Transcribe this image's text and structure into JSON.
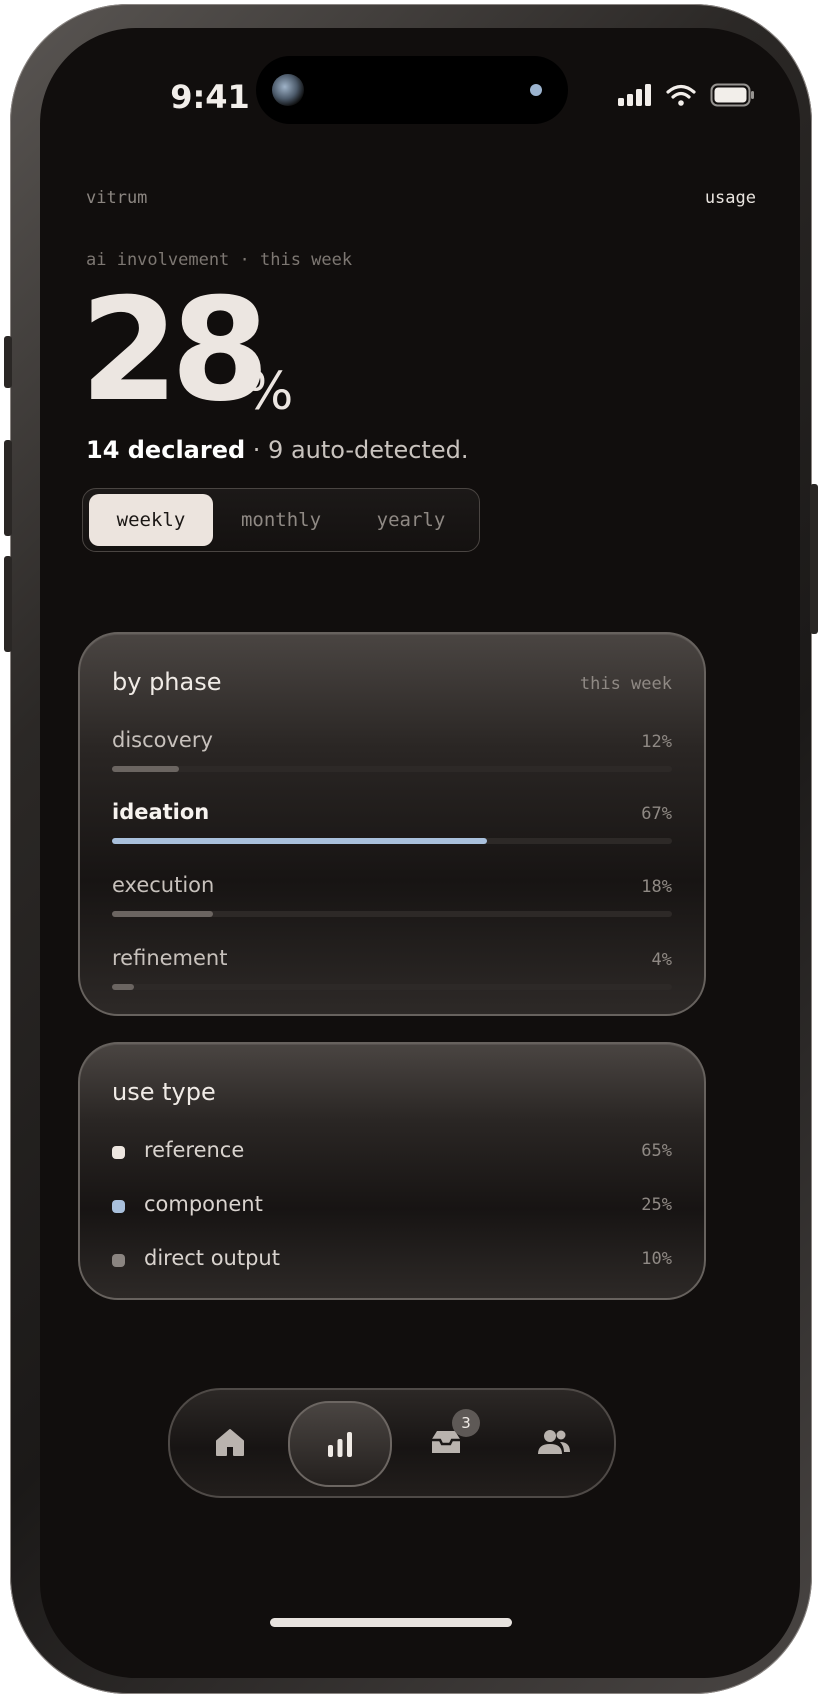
{
  "status_bar": {
    "time": "9:41"
  },
  "header": {
    "app_name": "vitrum",
    "usage_link": "usage"
  },
  "summary": {
    "label": "ai involvement · this week",
    "value": "28",
    "unit": "%",
    "declared": "14 declared",
    "auto_detected": " · 9 auto-detected."
  },
  "period_tabs": [
    "weekly",
    "monthly",
    "yearly"
  ],
  "period_selected": "weekly",
  "by_phase": {
    "title": "by phase",
    "period": "this week",
    "items": [
      {
        "label": "discovery",
        "percent_text": "12%",
        "fraction": 0.12,
        "highlight": false
      },
      {
        "label": "ideation",
        "percent_text": "67%",
        "fraction": 0.67,
        "highlight": true
      },
      {
        "label": "execution",
        "percent_text": "18%",
        "fraction": 0.18,
        "highlight": false
      },
      {
        "label": "refinement",
        "percent_text": "4%",
        "fraction": 0.04,
        "highlight": false
      }
    ]
  },
  "use_type": {
    "title": "use type",
    "items": [
      {
        "label": "reference",
        "percent_text": "65%",
        "color": "#ede6e0"
      },
      {
        "label": "component",
        "percent_text": "25%",
        "color": "#a9c0dc"
      },
      {
        "label": "direct output",
        "percent_text": "10%",
        "color": "#8a8480"
      }
    ]
  },
  "tabbar": {
    "items": [
      {
        "icon": "home-icon",
        "active": false
      },
      {
        "icon": "bar-chart-icon",
        "active": true
      },
      {
        "icon": "inbox-icon",
        "active": false,
        "badge": "3"
      },
      {
        "icon": "people-icon",
        "active": false
      }
    ]
  },
  "colors": {
    "background": "#110e0d",
    "accent": "#a9c0dc",
    "text": "#ece6e1"
  }
}
